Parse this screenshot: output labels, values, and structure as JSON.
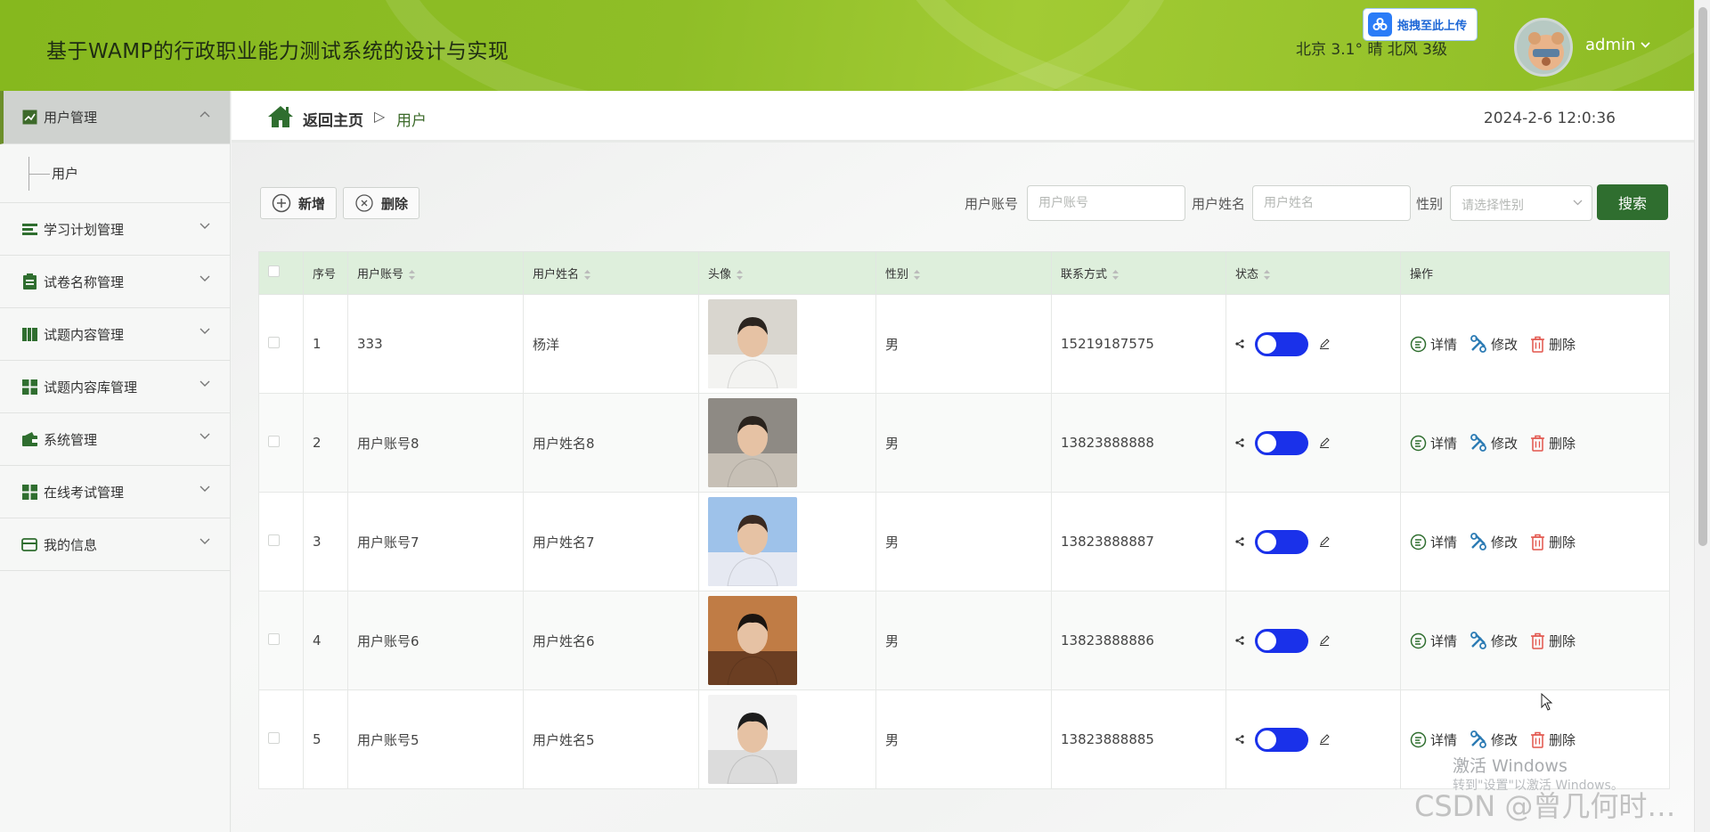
{
  "header": {
    "site_title": "基于WAMP的行政职业能力测试系统的设计与实现",
    "weather": "北京  3.1°  晴  北风  3级",
    "upload_label": "拖拽至此上传",
    "user_name": "admin"
  },
  "sidebar": {
    "items": [
      {
        "label": "用户管理",
        "icon": "chart-icon",
        "active": true,
        "expanded": true
      },
      {
        "label": "学习计划管理",
        "icon": "list-icon"
      },
      {
        "label": "试卷名称管理",
        "icon": "clipboard-icon"
      },
      {
        "label": "试题内容管理",
        "icon": "book-icon"
      },
      {
        "label": "试题内容库管理",
        "icon": "grid-icon"
      },
      {
        "label": "系统管理",
        "icon": "wallet-icon"
      },
      {
        "label": "在线考试管理",
        "icon": "grid-icon"
      },
      {
        "label": "我的信息",
        "icon": "card-icon"
      }
    ],
    "sub_items": [
      {
        "label": "用户"
      }
    ]
  },
  "breadcrumb": {
    "home": "返回主页",
    "separator": "▷",
    "current": "用户"
  },
  "datetime": "2024-2-6 12:0:36",
  "toolbar": {
    "add_label": "新增",
    "delete_label": "删除"
  },
  "search": {
    "account_label": "用户账号",
    "account_placeholder": "用户账号",
    "name_label": "用户姓名",
    "name_placeholder": "用户姓名",
    "gender_label": "性别",
    "gender_placeholder": "请选择性别",
    "button_label": "搜索"
  },
  "table": {
    "columns": [
      "序号",
      "用户账号",
      "用户姓名",
      "头像",
      "性别",
      "联系方式",
      "状态",
      "操作"
    ],
    "rows": [
      {
        "index": "1",
        "account": "333",
        "name": "杨洋",
        "gender": "男",
        "phone": "15219187575",
        "status_on": true
      },
      {
        "index": "2",
        "account": "用户账号8",
        "name": "用户姓名8",
        "gender": "男",
        "phone": "13823888888",
        "status_on": true
      },
      {
        "index": "3",
        "account": "用户账号7",
        "name": "用户姓名7",
        "gender": "男",
        "phone": "13823888887",
        "status_on": true
      },
      {
        "index": "4",
        "account": "用户账号6",
        "name": "用户姓名6",
        "gender": "男",
        "phone": "13823888886",
        "status_on": true
      },
      {
        "index": "5",
        "account": "用户账号5",
        "name": "用户姓名5",
        "gender": "男",
        "phone": "13823888885",
        "status_on": true
      }
    ],
    "actions": {
      "detail": "详情",
      "edit": "修改",
      "delete": "删除"
    }
  },
  "overlay": {
    "windows_line1": "激活 Windows",
    "windows_line2": "转到\"设置\"以激活 Windows。",
    "csdn_watermark": "CSDN @曾几何时…"
  },
  "colors": {
    "header_green": "#8fbe27",
    "accent_green": "#2f6e2f",
    "toggle_blue": "#1a31ea",
    "table_header": "#deefdc"
  }
}
